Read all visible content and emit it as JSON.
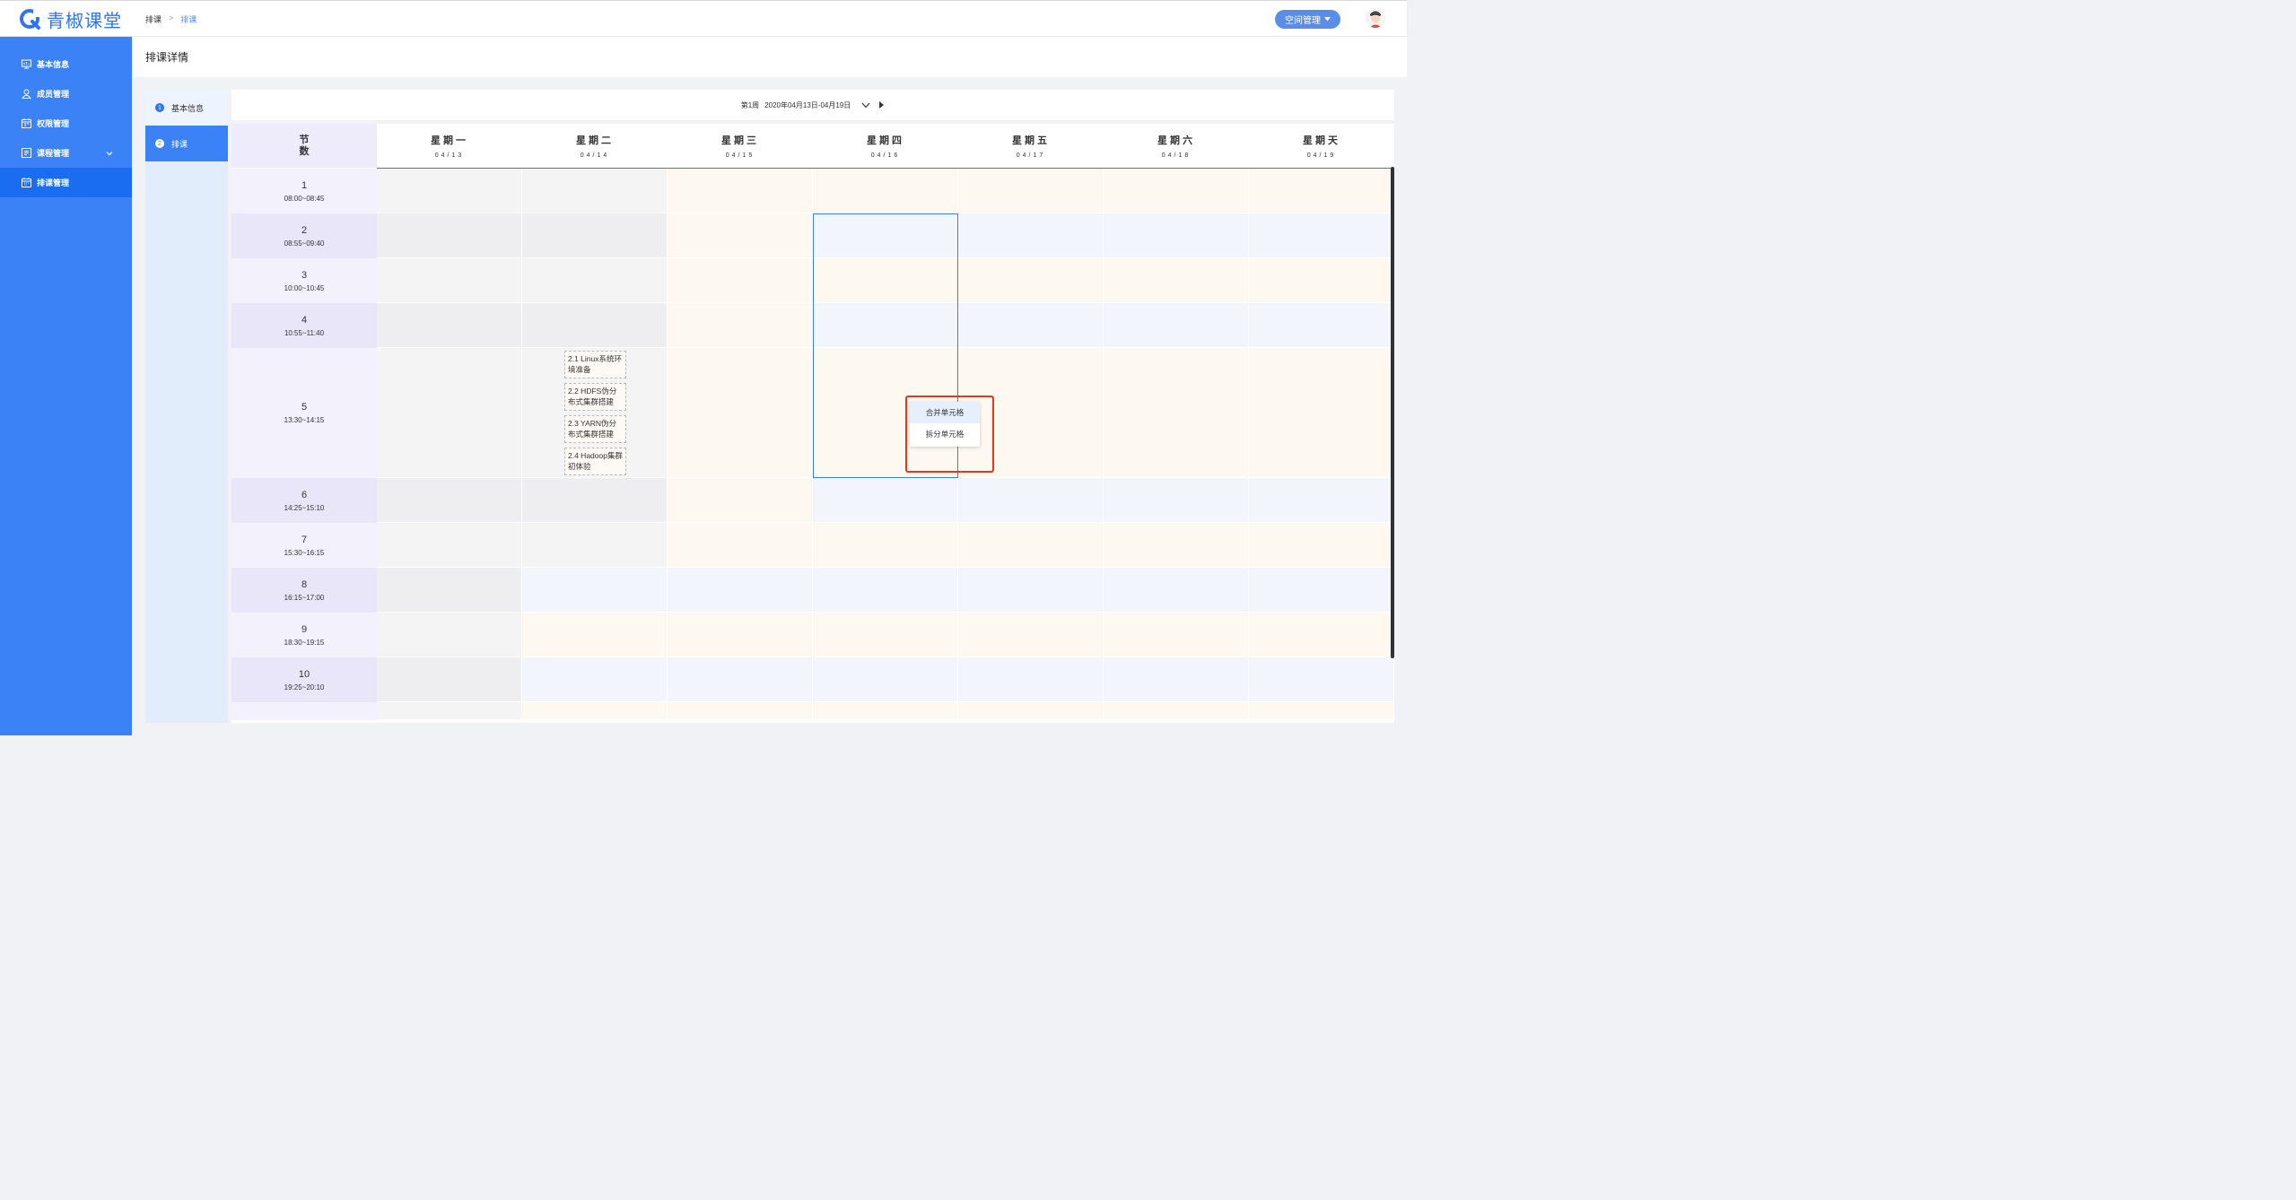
{
  "app": {
    "logo_text": "青椒课堂",
    "brand_color": "#2f74f0"
  },
  "breadcrumb": {
    "root": "排课",
    "separator": ">",
    "current": "排课"
  },
  "header": {
    "space_label": "空间管理",
    "space_icon": "caret-down-icon",
    "avatar_icon": "user-avatar-icon"
  },
  "sidebar": {
    "items": [
      {
        "label": "基本信息",
        "icon": "monitor-icon"
      },
      {
        "label": "成员管理",
        "icon": "user-icon"
      },
      {
        "label": "权限管理",
        "icon": "calendar-grid-icon"
      },
      {
        "label": "课程管理",
        "icon": "list-icon"
      },
      {
        "label": "排课管理",
        "icon": "calendar-icon",
        "active": true
      }
    ]
  },
  "page": {
    "title": "排课详情"
  },
  "steps": [
    {
      "num": "1",
      "label": "基本信息"
    },
    {
      "num": "2",
      "label": "排课",
      "active": true
    }
  ],
  "week": {
    "label": "第1周",
    "range": "2020年04月13日-04月19日"
  },
  "table": {
    "period_header": [
      "节",
      "数"
    ],
    "days": [
      {
        "name": "星期一",
        "date": "04/13"
      },
      {
        "name": "星期二",
        "date": "04/14"
      },
      {
        "name": "星期三",
        "date": "04/15"
      },
      {
        "name": "星期四",
        "date": "04/16"
      },
      {
        "name": "星期五",
        "date": "04/17"
      },
      {
        "name": "星期六",
        "date": "04/18"
      },
      {
        "name": "星期天",
        "date": "04/19"
      }
    ],
    "periods": [
      {
        "n": "1",
        "time": "08:00~08:45"
      },
      {
        "n": "2",
        "time": "08:55~09:40"
      },
      {
        "n": "3",
        "time": "10:00~10:45"
      },
      {
        "n": "4",
        "time": "10:55~11:40"
      },
      {
        "n": "5",
        "time": "13:30~14:15"
      },
      {
        "n": "6",
        "time": "14:25~15:10"
      },
      {
        "n": "7",
        "time": "15:30~16:15"
      },
      {
        "n": "8",
        "time": "16:15~17:00"
      },
      {
        "n": "9",
        "time": "18:30~19:15"
      },
      {
        "n": "10",
        "time": "19:25~20:10"
      }
    ],
    "lessons": [
      {
        "text": "2.1 Linux系统环境准备"
      },
      {
        "text": "2.2 HDFS伪分布式集群搭建"
      },
      {
        "text": "2.3 YARN伪分布式集群搭建"
      },
      {
        "text": "2.4 Hadoop集群初体验"
      }
    ]
  },
  "context_menu": {
    "items": [
      "合并单元格",
      "拆分单元格"
    ]
  }
}
